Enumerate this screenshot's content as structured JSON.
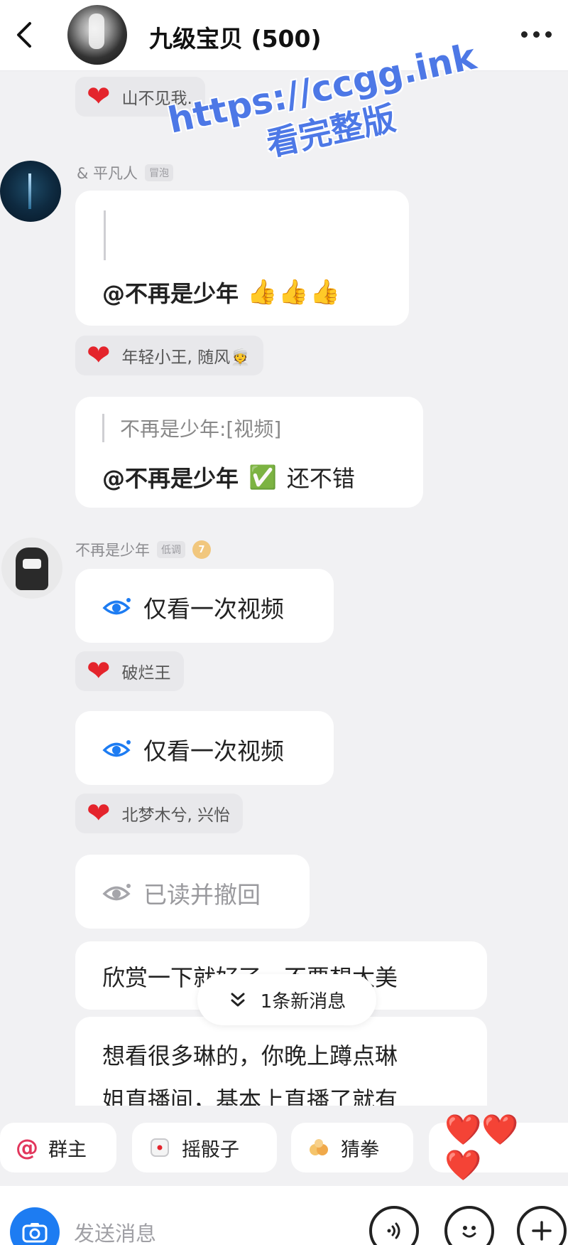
{
  "header": {
    "title": "九级宝贝 (500)"
  },
  "messages": {
    "reaction_top": {
      "names": "山不见我."
    },
    "msg1": {
      "sender": "& 平凡人",
      "sender_tag": "冒泡",
      "mention": "@不再是少年",
      "emoji": "👍👍👍"
    },
    "reaction1": {
      "names": "年轻小王, 随风👳"
    },
    "msg2": {
      "quote": "不再是少年:[视频]",
      "mention": "@不再是少年",
      "emoji": "✅",
      "text": "还不错"
    },
    "msg3": {
      "sender": "不再是少年",
      "sender_tag": "低调",
      "level": "7",
      "label": "仅看一次视频"
    },
    "reaction3": {
      "names": "破烂王"
    },
    "msg4": {
      "label": "仅看一次视频"
    },
    "reaction4": {
      "names": "北梦木兮, 兴怡"
    },
    "msg5": {
      "label": "已读并撤回"
    },
    "msg6": {
      "text": "欣赏一下就好了，不要想太美"
    },
    "msg7": {
      "line1": "想看很多琳的，你晚上蹲点琳",
      "line2": "姐直播间，基本上直播了就有"
    }
  },
  "new_messages": {
    "label": "1条新消息"
  },
  "quickbar": {
    "group_owner": "群主",
    "dice": "摇骰子",
    "rps": "猜拳",
    "hearts": "❤️❤️❤️"
  },
  "input": {
    "placeholder": "发送消息"
  },
  "watermark": {
    "line1": "https://ccgg.ink",
    "line2": "看完整版"
  },
  "colors": {
    "accent": "#1d7cf2",
    "heart": "#e4242c",
    "mention": "#1e3a6d",
    "watermark": "#4d78e6"
  }
}
